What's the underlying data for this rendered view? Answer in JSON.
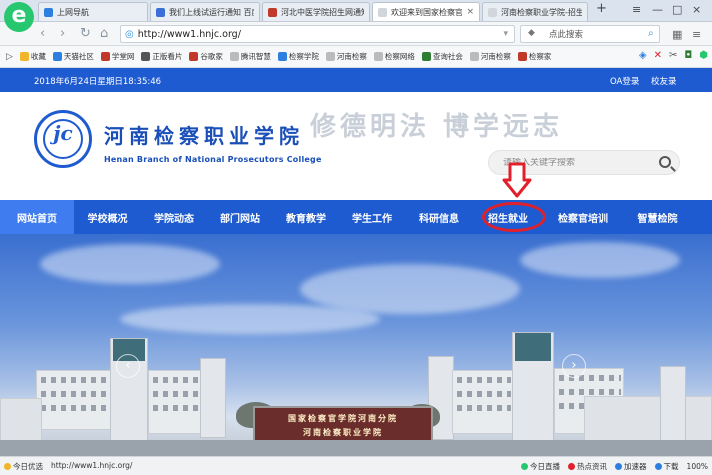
{
  "browser": {
    "tabs": [
      {
        "label": "上网导航",
        "icon_color": "#2d7fe0",
        "active": false
      },
      {
        "label": "我们上线试运行通知 百度",
        "icon_color": "#3b6ed8",
        "active": false
      },
      {
        "label": "河北中医学院招生网通知",
        "icon_color": "#c0392b",
        "active": false
      },
      {
        "label": "欢迎来到国家检察官学院",
        "icon_color": "#d0d6dc",
        "active": true
      },
      {
        "label": "河南检察职业学院-招生就",
        "icon_color": "#d0d6dc",
        "active": false
      }
    ],
    "new_tab": "+",
    "window_controls": [
      "≡",
      "—",
      "□",
      "×"
    ],
    "nav_buttons": [
      "‹",
      "›",
      "↻",
      "⌂"
    ],
    "url": "http://www1.hnjc.org/",
    "search_placeholder": "点此搜索",
    "bookmarks": [
      {
        "label": "收藏",
        "color": "#f1b52b"
      },
      {
        "label": "天猫社区",
        "color": "#2d7fe0"
      },
      {
        "label": "学堂网",
        "color": "#c0392b"
      },
      {
        "label": "正版看片",
        "color": "#555"
      },
      {
        "label": "谷歌家",
        "color": "#c0392b"
      },
      {
        "label": "腾讯智慧",
        "color": "#999"
      },
      {
        "label": "检察学院",
        "color": "#2d7fe0"
      },
      {
        "label": "河南检察",
        "color": "#999"
      },
      {
        "label": "检察网络",
        "color": "#999"
      },
      {
        "label": "查询社会",
        "color": "#2e7d32"
      },
      {
        "label": "河南检察",
        "color": "#999"
      },
      {
        "label": "检察家",
        "color": "#c0392b"
      }
    ]
  },
  "page": {
    "date": "2018年6月24日星期日18:35:46",
    "top_links": [
      "OA登录",
      "校友录"
    ],
    "emblem_letters": "jc",
    "college_name": "河南检察职业学院",
    "college_en": "Henan Branch of National Prosecutors College",
    "motto": "修德明法 博学远志",
    "search_placeholder": "请输入关键字搜索",
    "nav": [
      {
        "label": "网站首页",
        "active": true
      },
      {
        "label": "学校概况",
        "active": false
      },
      {
        "label": "学院动态",
        "active": false
      },
      {
        "label": "部门网站",
        "active": false
      },
      {
        "label": "教育教学",
        "active": false
      },
      {
        "label": "学生工作",
        "active": false
      },
      {
        "label": "科研信息",
        "active": false
      },
      {
        "label": "招生就业",
        "active": false
      },
      {
        "label": "检察官培训",
        "active": false
      },
      {
        "label": "智慧检院",
        "active": false
      }
    ],
    "gate_sign": [
      "国家检察官学院河南分院",
      "河南检察职业学院"
    ],
    "hero_arrows": [
      "‹",
      "›"
    ],
    "colors": {
      "brand_blue": "#1f5bd0",
      "active_nav": "#3f7cf0",
      "annotation_red": "#e0202a"
    }
  },
  "statusbar": {
    "left": [
      "今日优选",
      "http://www1.hnjc.org/"
    ],
    "right": [
      "今日直播",
      "热点资讯",
      "加速器",
      "下载",
      "100%"
    ]
  }
}
